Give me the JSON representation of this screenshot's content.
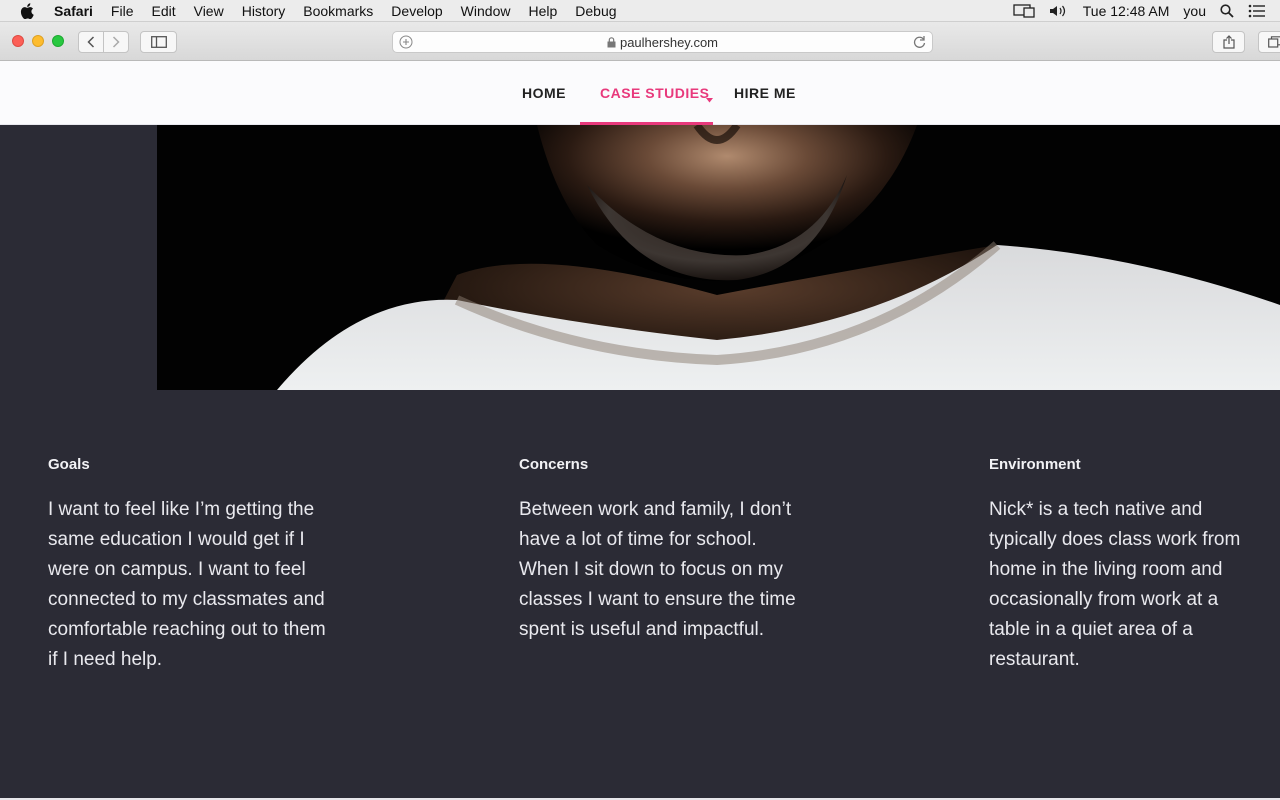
{
  "menubar": {
    "app": "Safari",
    "items": [
      "File",
      "Edit",
      "View",
      "History",
      "Bookmarks",
      "Develop",
      "Window",
      "Help",
      "Debug"
    ],
    "clock": "Tue 12:48 AM",
    "user": "you"
  },
  "browser": {
    "url": "paulhershey.com"
  },
  "nav": {
    "home": "HOME",
    "case_studies": "CASE STUDIES",
    "hire_me": "HIRE ME",
    "active_color": "#e8397c"
  },
  "persona": {
    "goals": {
      "title": "Goals",
      "text": "I want to feel like I’m getting the same education I would get if I were on campus. I want to feel connected to my classmates and comfortable reaching out to them if I need help."
    },
    "concerns": {
      "title": "Concerns",
      "text": "Between work and family, I don’t have a lot of time for school. When I sit down to focus on my classes I want to ensure the time spent is useful and impactful."
    },
    "environment": {
      "title": "Environment",
      "text": "Nick* is a tech native and typically does class work from home in the living room and occasionally from work at a table in a quiet area of a restaurant."
    }
  },
  "colors": {
    "page_bg": "#2b2b35",
    "accent": "#e8397c"
  }
}
